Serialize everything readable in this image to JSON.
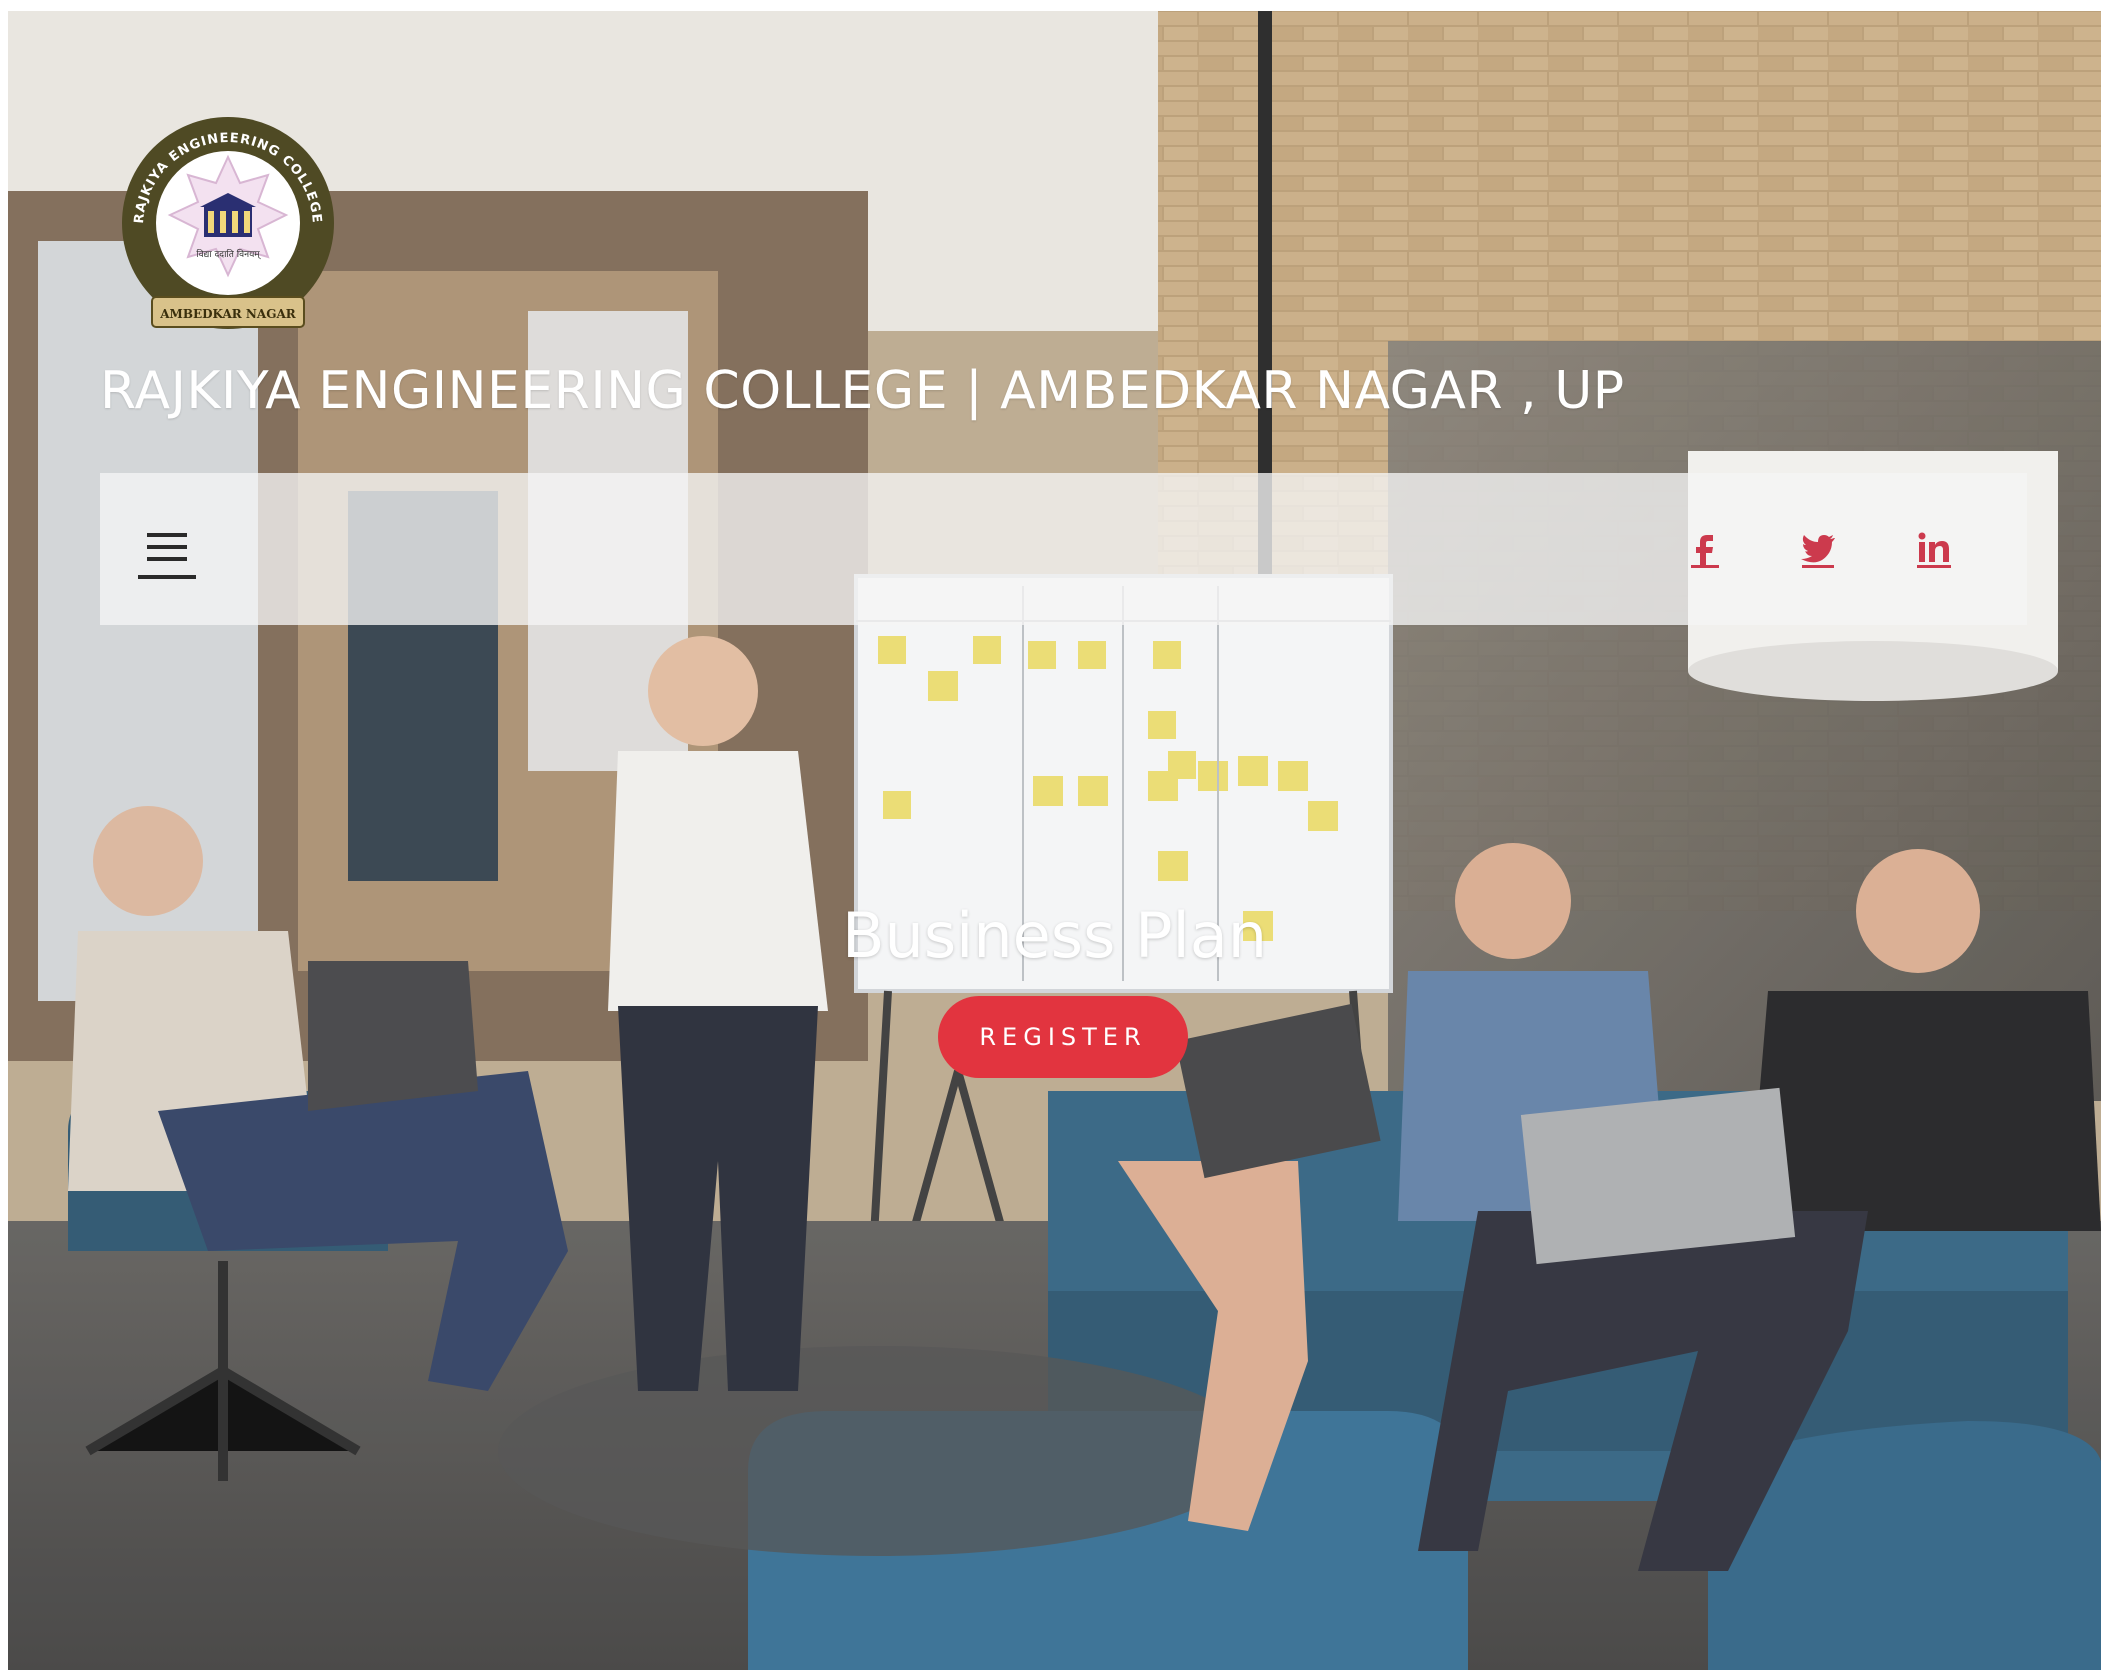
{
  "header": {
    "logo": {
      "arc_text_top": "RAJKIYA ENGINEERING COLLEGE",
      "center_text": "विद्या ददाति विनयम्",
      "banner_text": "AMBEDKAR NAGAR"
    },
    "site_title": "RAJKIYA ENGINEERING COLLEGE | AMBEDKAR NAGAR , UP"
  },
  "navbar": {
    "menu_icon": "hamburger-icon",
    "social": [
      {
        "name": "facebook",
        "icon": "facebook-icon",
        "glyph": "f"
      },
      {
        "name": "twitter",
        "icon": "twitter-icon"
      },
      {
        "name": "linkedin",
        "icon": "linkedin-icon",
        "glyph": "in"
      }
    ]
  },
  "hero": {
    "headline": "Business Plan",
    "cta_label": "REGISTER"
  },
  "colors": {
    "accent": "#e2343f",
    "social_icon": "#cc3a4d",
    "nav_bg": "#f5f5f5",
    "text_on_hero": "#ffffff"
  }
}
